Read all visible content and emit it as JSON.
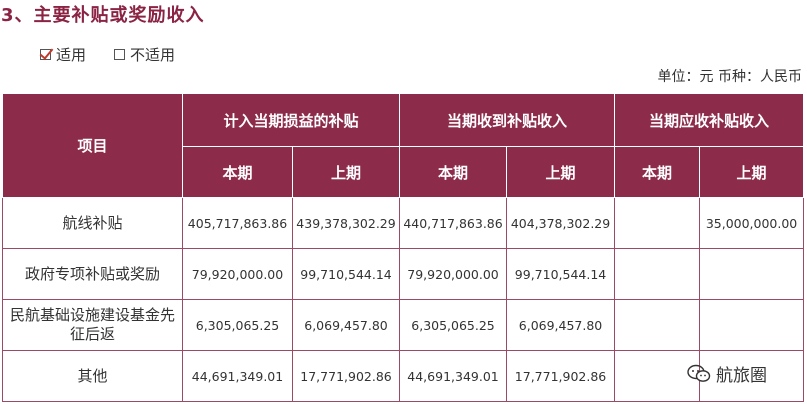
{
  "title": "3、主要补贴或奖励收入",
  "options": {
    "applicable": {
      "label": "适用",
      "checked": true
    },
    "not_applicable": {
      "label": "不适用",
      "checked": false
    }
  },
  "unit_text": "单位：元  币种：人民币",
  "table": {
    "headers": {
      "item": "项目",
      "group1": "计入当期损益的补贴",
      "group2": "当期收到补贴收入",
      "group3": "当期应收补贴收入",
      "current": "本期",
      "previous": "上期"
    },
    "rows": [
      {
        "item": "航线补贴",
        "c1": "405,717,863.86",
        "c2": "439,378,302.29",
        "c3": "440,717,863.86",
        "c4": "404,378,302.29",
        "c5": "",
        "c6": "35,000,000.00"
      },
      {
        "item": "政府专项补贴或奖励",
        "c1": "79,920,000.00",
        "c2": "99,710,544.14",
        "c3": "79,920,000.00",
        "c4": "99,710,544.14",
        "c5": "",
        "c6": ""
      },
      {
        "item": "民航基础设施建设基金先征后返",
        "c1": "6,305,065.25",
        "c2": "6,069,457.80",
        "c3": "6,305,065.25",
        "c4": "6,069,457.80",
        "c5": "",
        "c6": ""
      },
      {
        "item": "其他",
        "c1": "44,691,349.01",
        "c2": "17,771,902.86",
        "c3": "44,691,349.01",
        "c4": "17,771,902.86",
        "c5": "",
        "c6": ""
      }
    ]
  },
  "watermark": {
    "text": "航旅圈",
    "icon": "wechat-icon"
  },
  "colors": {
    "header_bg": "#8c2b4a",
    "title": "#8a2344",
    "border": "#9a4a62"
  }
}
